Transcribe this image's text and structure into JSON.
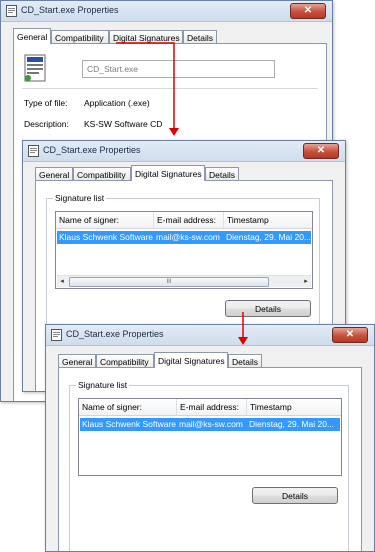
{
  "window1": {
    "title": "CD_Start.exe Properties",
    "close_label": "✕",
    "tabs": [
      "General",
      "Compatibility",
      "Digital Signatures",
      "Details"
    ],
    "active_tab": "General",
    "file_name": "CD_Start.exe",
    "type_label": "Type of file:",
    "type_value": "Application (.exe)",
    "description_label": "Description:",
    "description_value": "KS-SW Software CD"
  },
  "window2": {
    "title": "CD_Start.exe Properties",
    "close_label": "✕",
    "tabs": [
      "General",
      "Compatibility",
      "Digital Signatures",
      "Details"
    ],
    "active_tab": "Digital Signatures",
    "signature_list_label": "Signature list",
    "columns": [
      "Name of signer:",
      "E-mail address:",
      "Timestamp"
    ],
    "rows": [
      {
        "name": "Klaus Schwenk Software",
        "email": "mail@ks-sw.com",
        "timestamp": "Dienstag, 29. Mai 20..."
      }
    ],
    "details_button": "Details"
  },
  "window3": {
    "title": "CD_Start.exe Properties",
    "close_label": "✕",
    "tabs": [
      "General",
      "Compatibility",
      "Digital Signatures",
      "Details"
    ],
    "active_tab": "Digital Signatures",
    "signature_list_label": "Signature list",
    "columns": [
      "Name of signer:",
      "E-mail address:",
      "Timestamp"
    ],
    "rows": [
      {
        "name": "Klaus Schwenk Software",
        "email": "mail@ks-sw.com",
        "timestamp": "Dienstag, 29. Mai 20..."
      }
    ],
    "details_button": "Details"
  },
  "scrollbar": {
    "left_arrow": "◂",
    "right_arrow": "▸",
    "grip": "III"
  },
  "colors": {
    "arrow": "#e00000",
    "selection": "#3399ff",
    "close_button": "#c6503c"
  }
}
